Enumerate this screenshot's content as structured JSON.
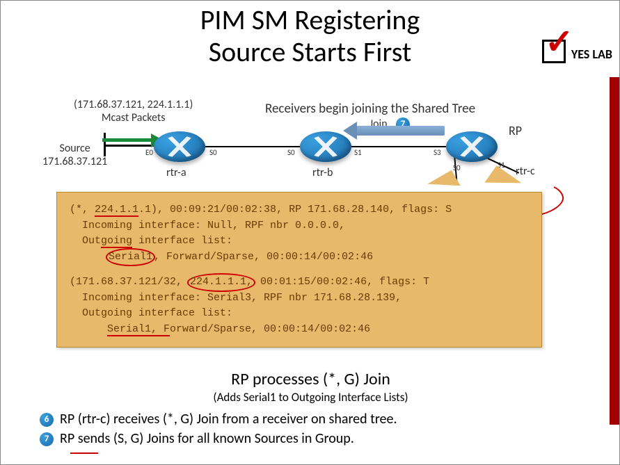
{
  "title": {
    "line1": "PIM SM Registering",
    "line2": "Source Starts First"
  },
  "logo": {
    "text": "YES LAB"
  },
  "diagram": {
    "mcast_header": "(171.68.37.121, 224.1.1.1)",
    "mcast_sub": "Mcast Packets",
    "receivers_label": "Receivers begin joining the Shared Tree",
    "source_label": "Source",
    "source_ip": "171.68.37.121",
    "routers": {
      "a": "rtr-a",
      "b": "rtr-b",
      "c": "rtr-c"
    },
    "interfaces": {
      "a_e0": "E0",
      "a_s0": "S0",
      "b_s0": "S0",
      "b_s1": "S1",
      "c_s3": "S3",
      "c_s0": "S0",
      "c_s1": "S1"
    },
    "join_label": "Join",
    "join_step": "7",
    "rp_label": "RP"
  },
  "callout": {
    "l1a": "(*, ",
    "l1b": "224.1.1",
    "l1c": ".1), 00:09:21/00:02:38, RP 171.68.28.140, flags: S",
    "l2": "Incoming interface: Null, RPF nbr 0.0.0.0,",
    "l3a": "Out",
    "l3b": "going",
    "l3c": " interface list:",
    "l4a": "Serial1",
    "l4b": ", Forward/Sparse, 00:00:14/00:02:46",
    "l5a": "(171.68.37.121/32, ",
    "l5b": "224.1.1.1,",
    "l5c": " 00:01:15/00:02:46, flags: T",
    "l6": "Incoming interface: Serial3, RPF nbr 171.68.28.139,",
    "l7": "Outgoing interface list:",
    "l8a": "Serial1, ",
    "l8b": "F",
    "l8c": "orward/Sparse, 00:00:14/00:02:46"
  },
  "subcap": {
    "line1": "RP processes (*, G) Join",
    "line2": "(Adds Serial1 to Outgoing Interface Lists)"
  },
  "steps": {
    "s6_num": "6",
    "s6_text": "RP (rtr-c) receives (*, G) Join from a receiver on shared tree.",
    "s7_num": "7",
    "s7_text": "RP sends (S, G) Joins for all known Sources in Group."
  }
}
